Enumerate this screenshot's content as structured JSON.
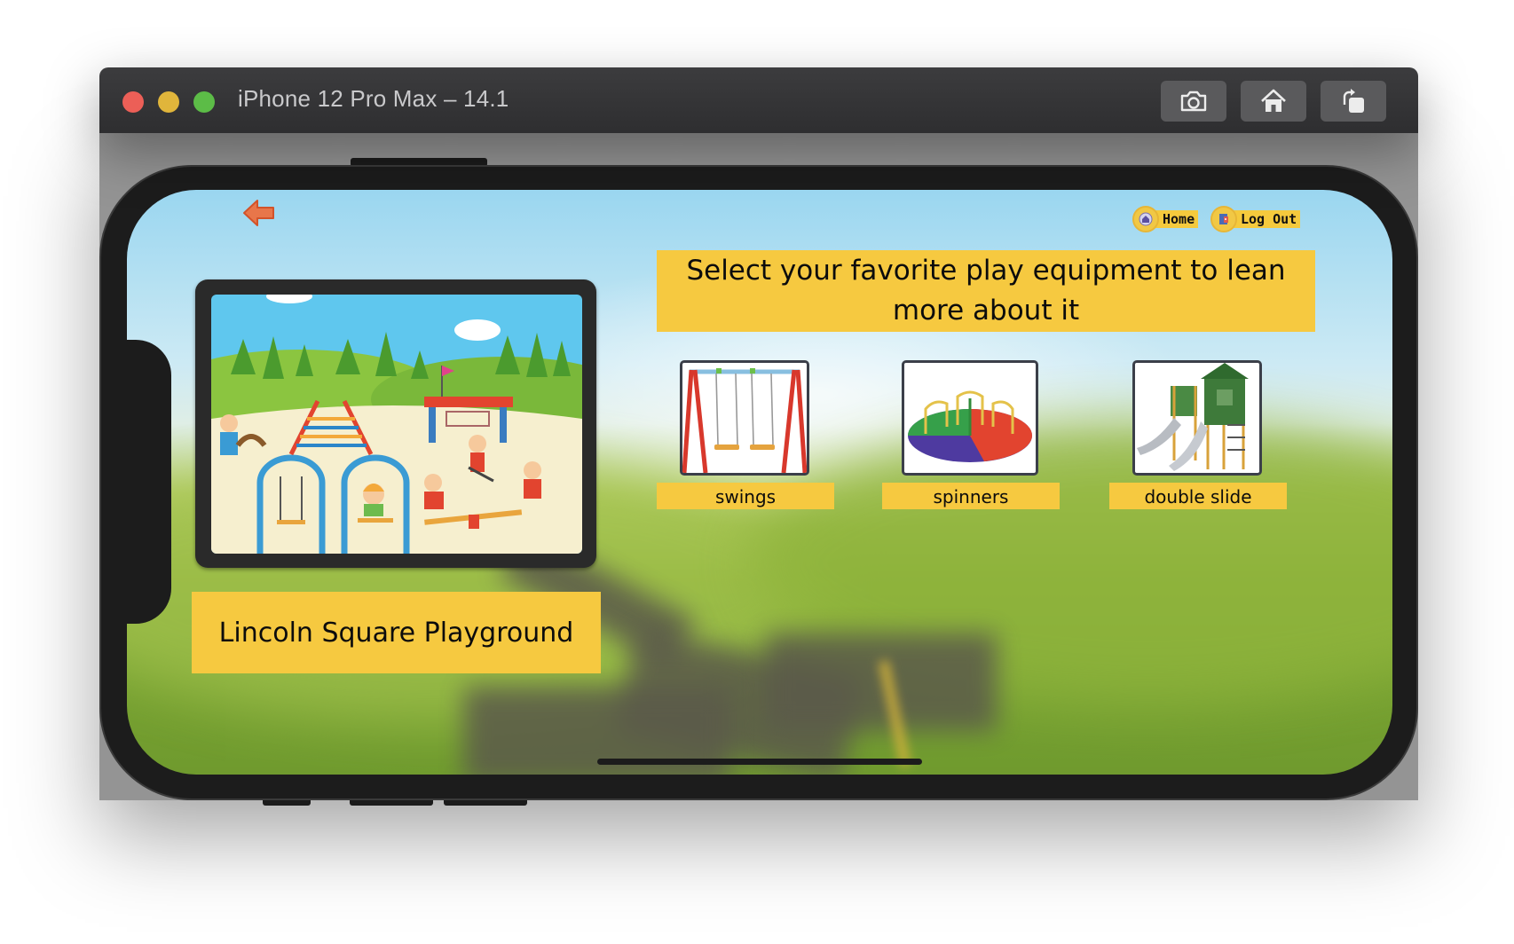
{
  "window": {
    "title": "iPhone 12 Pro Max – 14.1",
    "toolbar": [
      {
        "name": "screenshot",
        "icon": "camera-icon"
      },
      {
        "name": "home",
        "icon": "home-icon"
      },
      {
        "name": "rotate",
        "icon": "rotate-icon"
      }
    ]
  },
  "app": {
    "nav": {
      "home_label": "Home",
      "logout_label": "Log Out"
    },
    "heading": "Select your favorite play equipment to lean more about it",
    "playground_name": "Lincoln Square Playground",
    "equipment": [
      {
        "label": "swings",
        "icon": "swings-image"
      },
      {
        "label": "spinners",
        "icon": "spinners-image"
      },
      {
        "label": "double slide",
        "icon": "double-slide-image"
      }
    ],
    "colors": {
      "accent": "#f6c940",
      "back_arrow": "#e8764a"
    }
  }
}
